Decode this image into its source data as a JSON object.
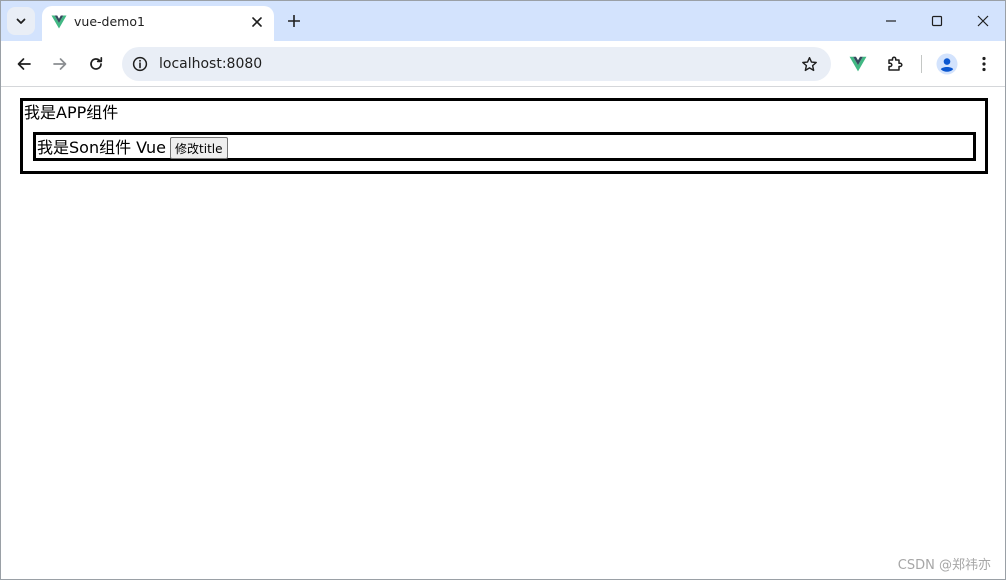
{
  "browser": {
    "tab": {
      "title": "vue-demo1",
      "favicon": "vue-logo-icon"
    },
    "address_bar": {
      "url": "localhost:8080"
    },
    "icons": {
      "tab_search": "chevron-down-icon",
      "new_tab": "plus-icon",
      "minimize": "minimize-icon",
      "maximize": "maximize-icon",
      "close": "close-icon",
      "back": "back-arrow-icon",
      "forward": "forward-arrow-icon",
      "reload": "reload-icon",
      "site_info": "info-icon",
      "bookmark": "star-icon",
      "vue_devtools": "vue-devtools-icon",
      "extensions": "puzzle-icon",
      "profile": "profile-icon",
      "menu": "kebab-menu-icon"
    },
    "colors": {
      "tabstrip_bg": "#d3e3fd",
      "omnibox_bg": "#e9eef6",
      "vue_green": "#41b883",
      "vue_dark": "#35495e",
      "profile_blue": "#0b57d0"
    }
  },
  "page": {
    "app_text": "我是APP组件",
    "son": {
      "text": "我是Son组件 Vue",
      "button_label": "修改title"
    },
    "watermark": "CSDN @郑祎亦"
  }
}
